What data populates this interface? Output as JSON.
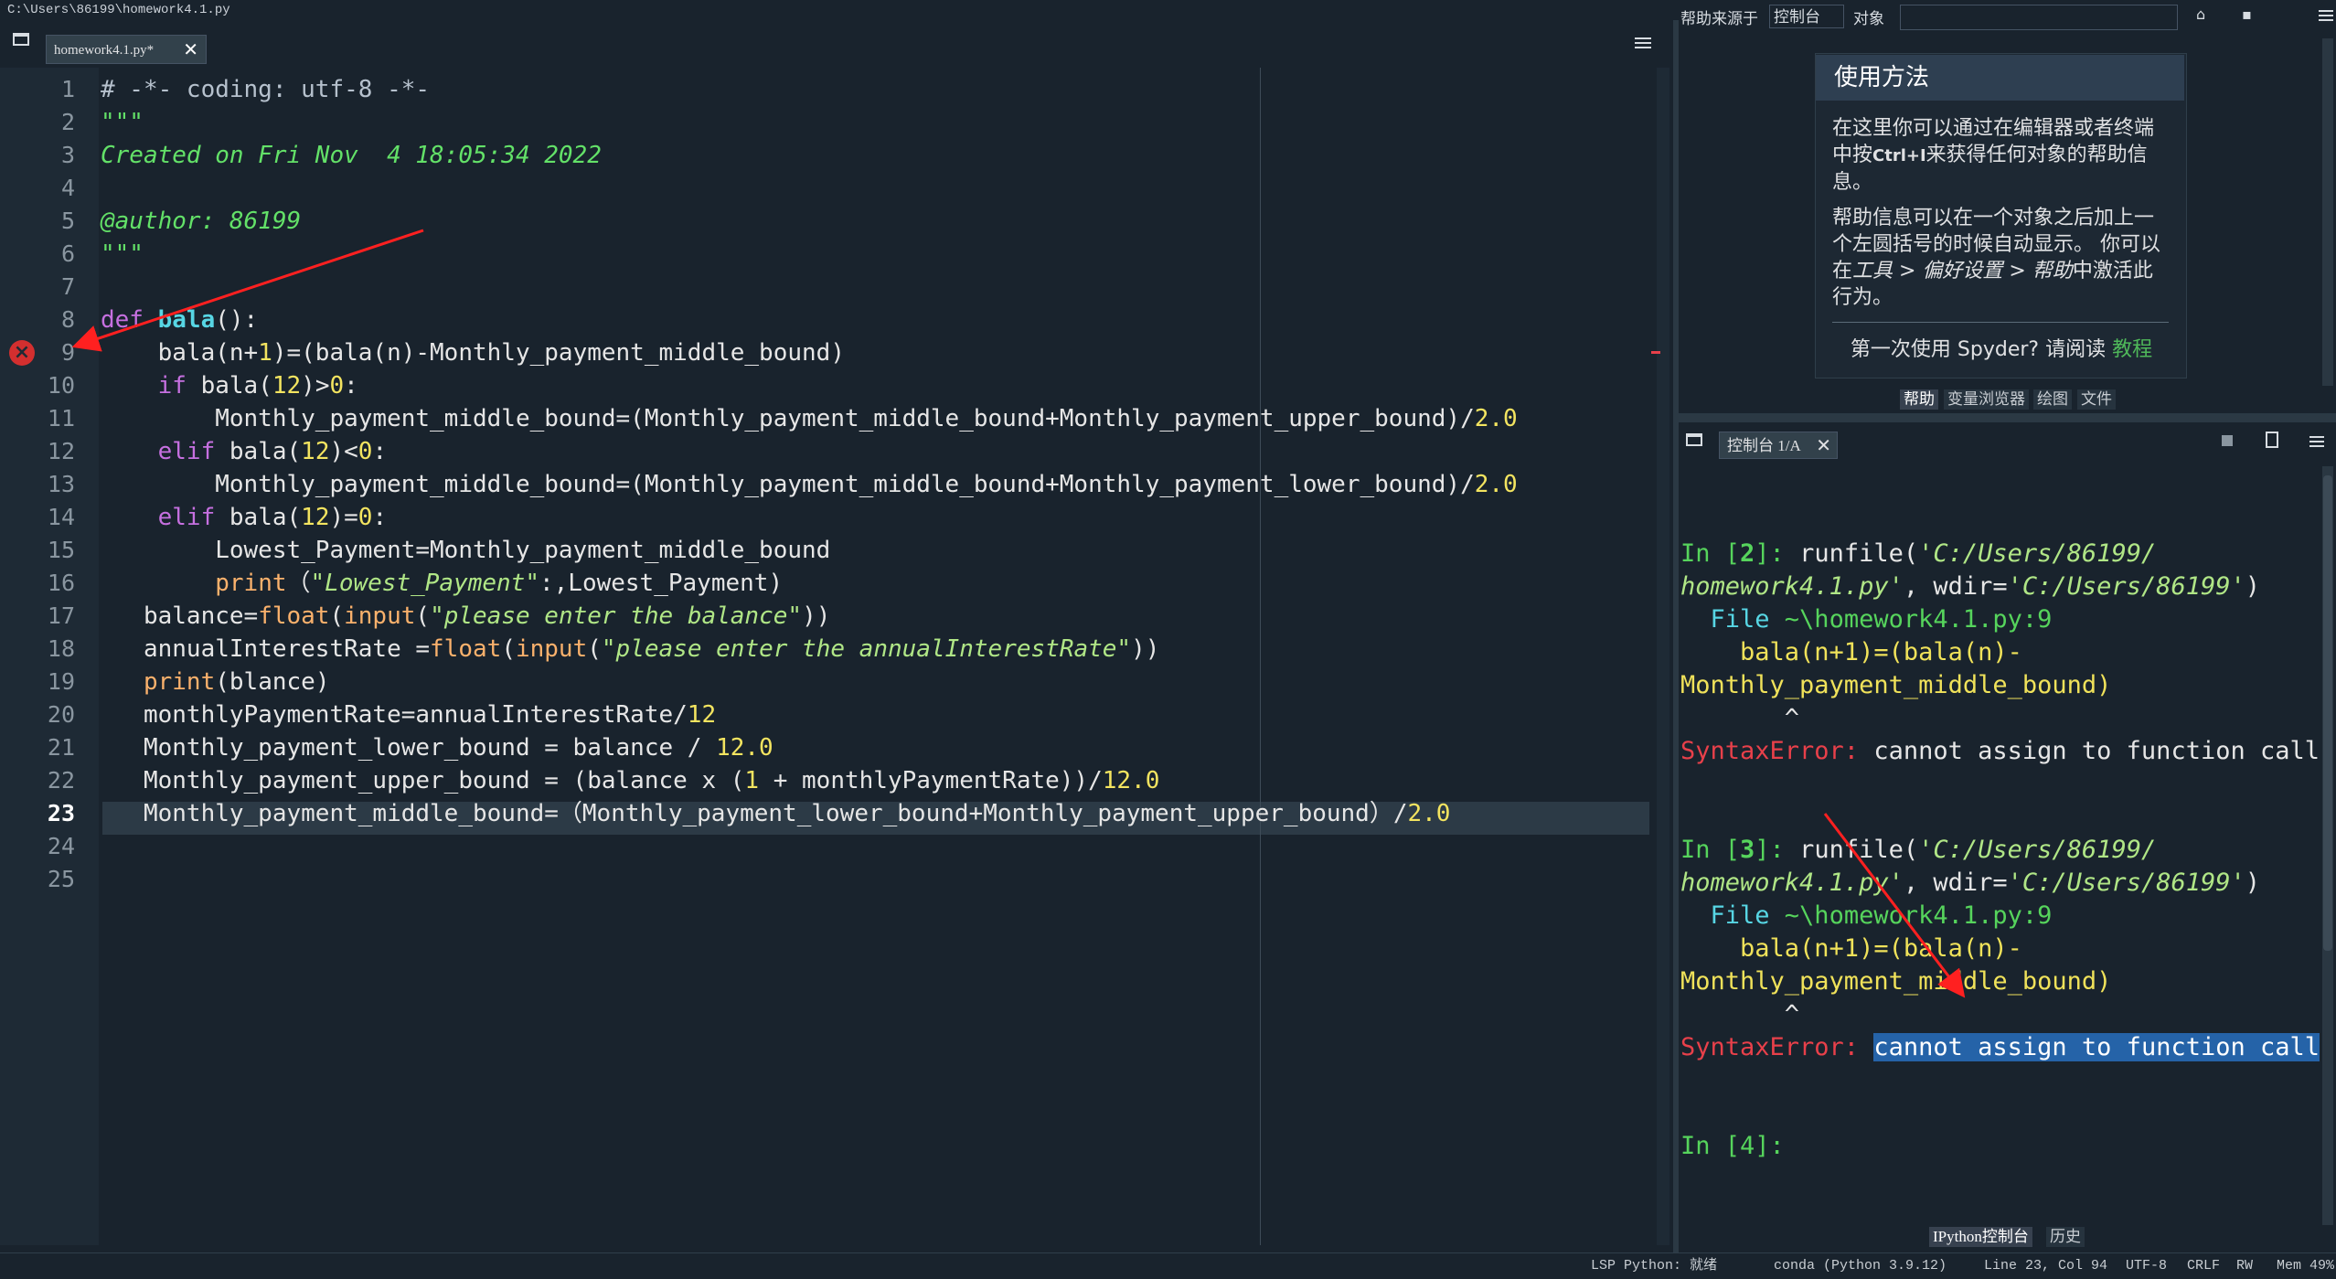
{
  "window": {
    "path": "C:\\Users\\86199\\homework4.1.py"
  },
  "editor": {
    "tab_label": "homework4.1.py*",
    "close_glyph": "✕",
    "current_line": 23,
    "error_line": 9,
    "line_numbers": [
      "1",
      "2",
      "3",
      "4",
      "5",
      "6",
      "7",
      "8",
      "9",
      "10",
      "11",
      "12",
      "13",
      "14",
      "15",
      "16",
      "17",
      "18",
      "19",
      "20",
      "21",
      "22",
      "23",
      "24",
      "25"
    ]
  },
  "help": {
    "source_label": "帮助来源于",
    "source_value": "控制台",
    "object_label": "对象",
    "card_title": "使用方法",
    "para1_a": "在这里你可以通过在编辑器或者终端中按",
    "para1_key": "Ctrl+I",
    "para1_b": "来获得任何对象的帮助信息。",
    "para2_a": "帮助信息可以在一个对象之后加上一个左圆括号的时候自动显示。 你可以在",
    "para2_menu": "工具 > 偏好设置 > 帮助",
    "para2_b": "中激活此行为。",
    "first_use": "第一次使用 Spyder? 请阅读",
    "tutorial_link": "教程",
    "tabs": [
      "帮助",
      "变量浏览器",
      "绘图",
      "文件"
    ]
  },
  "console": {
    "tab_label": "控制台 1/A",
    "blocks": [
      {
        "prompt_in": "In [",
        "prompt_num": "2",
        "prompt_close": "]: ",
        "call": "runfile(",
        "file_arg": "'C:/Users/86199/",
        "file_arg2": "homework4.1.py'",
        "wdir": ", wdir=",
        "wdir_val": "'C:/Users/86199'",
        "close": ")",
        "file_label": "  File ",
        "file_loc": "~\\homework4.1.py:9",
        "src1": "    bala(n+1)=(bala(n)-",
        "src2": "Monthly_payment_middle_bound)",
        "caret": "       ^",
        "err_type": "SyntaxError:",
        "err_msg": " cannot assign to function call"
      },
      {
        "prompt_in": "In [",
        "prompt_num": "3",
        "prompt_close": "]: ",
        "call": "runfile(",
        "file_arg": "'C:/Users/86199/",
        "file_arg2": "homework4.1.py'",
        "wdir": ", wdir=",
        "wdir_val": "'C:/Users/86199'",
        "close": ")",
        "file_label": "  File ",
        "file_loc": "~\\homework4.1.py:9",
        "src1": "    bala(n+1)=(bala(n)-",
        "src2": "Monthly_payment_middle_bound)",
        "caret": "       ^",
        "err_type": "SyntaxError:",
        "err_msg": "cannot assign to function call"
      }
    ],
    "next_prompt": "In [4]:",
    "tabs": [
      "IPython控制台",
      "历史"
    ]
  },
  "statusbar": {
    "lsp": "LSP Python: 就绪",
    "conda": "conda (Python 3.9.12)",
    "position": "Line 23, Col 94",
    "encoding": "UTF-8",
    "eol": "CRLF",
    "perm": "RW",
    "mem": "Mem 49%"
  },
  "colors": {
    "background": "#19232d",
    "keyword": "#c670e0",
    "number": "#f3e460",
    "docstring": "#63e168",
    "string": "#b0e686",
    "error": "#e8404a",
    "annotation_arrow": "#ff2020"
  }
}
